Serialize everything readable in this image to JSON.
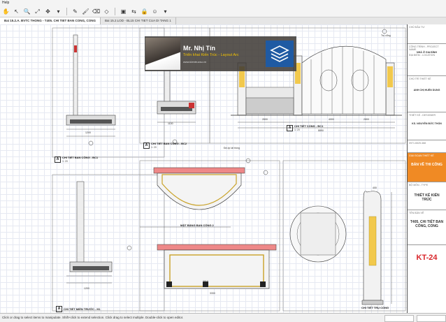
{
  "menubar": {
    "title": "Help"
  },
  "toolbar": {
    "icons": [
      "hand-icon",
      "select-icon",
      "zoom-icon",
      "fit-icon",
      "pan-icon",
      "pen-icon",
      "brush-icon",
      "eraser-icon",
      "shape-icon",
      "page-icon",
      "compare-icon",
      "user-icon"
    ]
  },
  "tabs": [
    {
      "label": "Bai 15.2.A. BVTC THONG - T405. CHI TIET BAN CONG, CONG",
      "active": true
    },
    {
      "label": "Bai 15.2.LOD - BL15 CHI TIET CUA DI TANG 1",
      "active": false
    }
  ],
  "watermark": {
    "name": "Mr. Nhị Tín",
    "subtitle": "Triển khai Kiến Trúc - Layout Arc",
    "site": "www.kientrucsu.vn"
  },
  "drawings": {
    "bc1": {
      "tag": "A",
      "title": "CHI TIẾT BAN CÔNG - BC1",
      "scale": "1: 20"
    },
    "bc2": {
      "tag": "A",
      "title": "CHI TIẾT BAN CÔNG - BC2",
      "scale": "1: 20"
    },
    "gate": {
      "tag": "A",
      "title": "CHI TIẾT CỔNG - ĐC1",
      "scale": "1: 20"
    },
    "plan": {
      "tag": "",
      "title": "MẶT BẰNG BAN CÔNG 2",
      "scale": "1: 20"
    },
    "column": {
      "tag": "",
      "title": "CHI TIẾT TRỤ CỔNG",
      "scale": "1: 20"
    },
    "bc3": {
      "tag": "A",
      "title": "CHI TIẾT BAN CÔNG - BC3",
      "scale": "1: 20"
    },
    "bc1b": {
      "tag": "A",
      "title": "CHI TIẾT MIỀN TRƯỚC - H1",
      "scale": "1: 20"
    }
  },
  "dims": {
    "d1": "1200",
    "d2": "1130",
    "d3": "400",
    "d4": "2800",
    "d5": "4000",
    "d6": "2800",
    "d7": "8850",
    "d8": "1340",
    "d9": "1200",
    "d10": "2010",
    "d11": "3330",
    "d12": "3100",
    "d13": "3500"
  },
  "notes": {
    "n1": "Trụ cổng",
    "n2": "Đá ốp lát trồng"
  },
  "titleblock": {
    "chu_dau_tu_label": "CHỦ ĐẦU TƯ",
    "cong_trinh_label": "CÔNG TRÌNH - PROJECT NAME",
    "cong_trinh": "NHÀ Ở GIA ĐÌNH",
    "dia_diem_label": "ĐỊA ĐIỂM - LOCATION",
    "chu_tri_label": "CHỦ TRÌ THIẾT KẾ",
    "kts": "ANH CHỊ HUẾN DUNG",
    "thiet_ke_label": "THIẾT KẾ - DESIGNER",
    "kts2": "KS. NGUYỄN ĐỨC THỐN",
    "phone": "0971.6525.468",
    "hang_muc_label": "GIAI ĐOẠN THIẾT KẾ",
    "hang_muc": "BẢN VẼ THI CÔNG",
    "bo_mon_label": "BỘ MÔN - TYPE",
    "bo_mon": "THIẾT KẾ KIẾN TRÚC",
    "ten_ban_ve_label": "TÊN BẢN VẼ",
    "ten_ban_ve": "T405. CHI TIẾT BAN CÔNG, CỔNG",
    "so_hieu": "KT-24",
    "accent": "#f08a24",
    "code_color": "#d9262b"
  },
  "statusbar": {
    "text": "Click or drag to select items to manipulate. Shift+click to extend selection. Click drag to select multiple. Double-click to open editor."
  }
}
